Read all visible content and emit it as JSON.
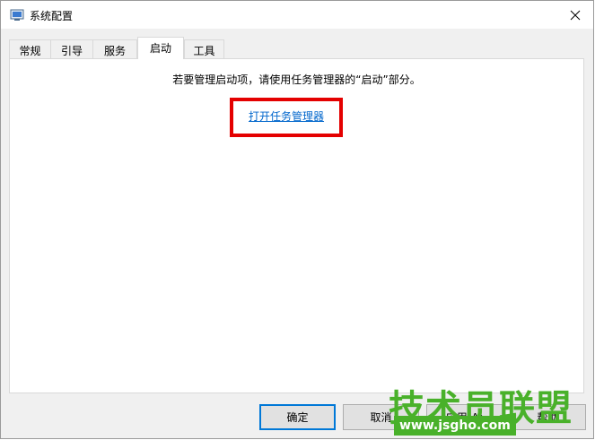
{
  "window": {
    "title": "系统配置"
  },
  "tabs": [
    {
      "label": "常规"
    },
    {
      "label": "引导"
    },
    {
      "label": "服务"
    },
    {
      "label": "启动"
    },
    {
      "label": "工具"
    }
  ],
  "startup": {
    "instruction": "若要管理启动项，请使用任务管理器的“启动”部分。",
    "link": "打开任务管理器"
  },
  "buttons": {
    "ok": "确定",
    "cancel": "取消",
    "apply": "应用(A)",
    "help": "帮助"
  },
  "watermark": {
    "main": "技术员联盟",
    "url": "www.jsgho.com"
  },
  "colors": {
    "highlight": "#e40000",
    "link": "#0066cc",
    "watermark": "#49b12a"
  }
}
